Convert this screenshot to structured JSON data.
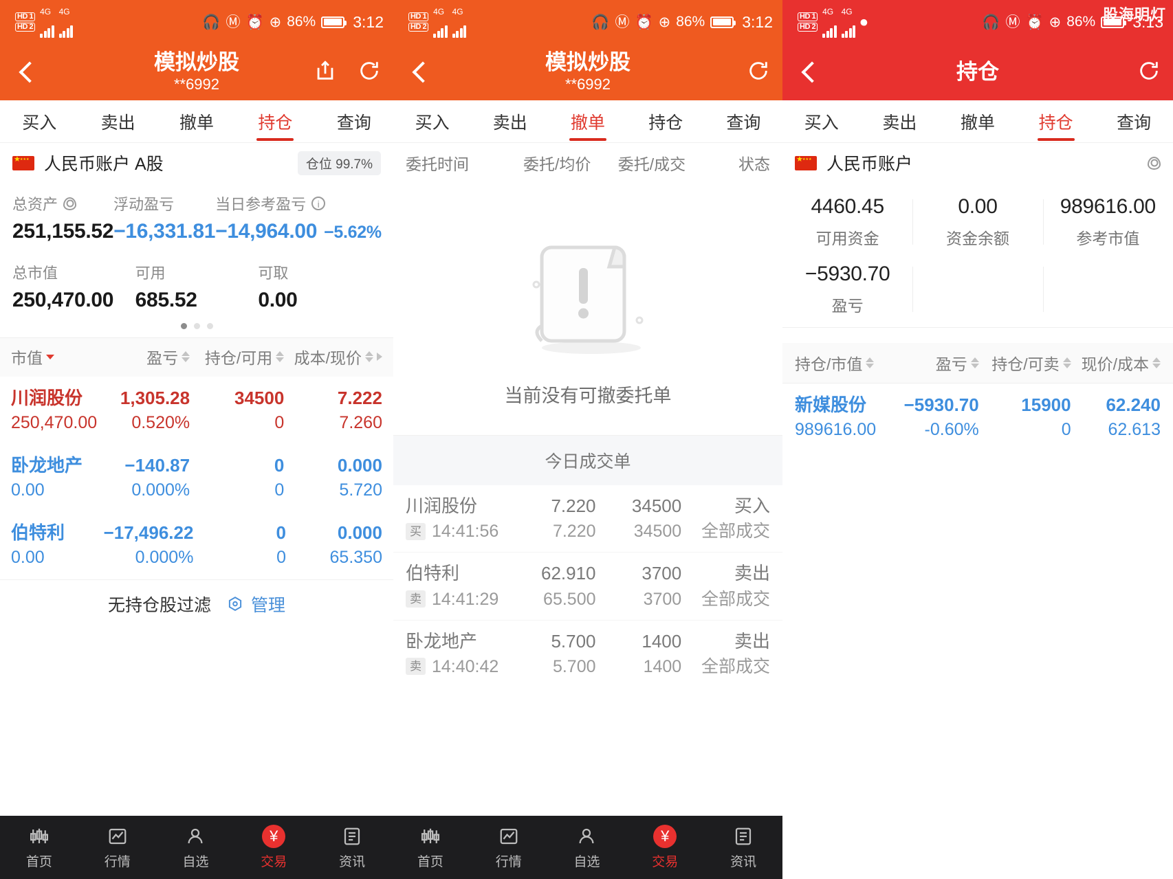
{
  "panel1": {
    "status": {
      "hd1": "HD 1",
      "hd2": "HD 2",
      "g1": "4G",
      "g2": "4G",
      "headset_icon": "headset-icon",
      "nfc_icon": "nfc-icon",
      "alarm_icon": "alarm-icon",
      "dnd_icon": "do-not-disturb-icon",
      "battery_pct": "86%",
      "time": "3:12"
    },
    "appbar": {
      "title": "模拟炒股",
      "subtitle": "**6992",
      "back_icon": "back-icon",
      "share_icon": "share-icon",
      "refresh_icon": "refresh-icon"
    },
    "tabs": [
      {
        "label": "买入",
        "active": false
      },
      {
        "label": "卖出",
        "active": false
      },
      {
        "label": "撤单",
        "active": false
      },
      {
        "label": "持仓",
        "active": true
      },
      {
        "label": "查询",
        "active": false
      }
    ],
    "account": {
      "name": "人民币账户 A股",
      "position_badge": "仓位 99.7%",
      "flag_icon": "china-flag-icon"
    },
    "assets": [
      {
        "label": "总资产",
        "value": "251,155.52",
        "icon": "eye-icon",
        "color": "dark"
      },
      {
        "label": "浮动盈亏",
        "value": "−16,331.81",
        "icon": "",
        "color": "blue"
      },
      {
        "label": "当日参考盈亏",
        "value": "−14,964.00",
        "sub": "−5.62%",
        "icon": "info-icon",
        "color": "blue"
      },
      {
        "label": "总市值",
        "value": "250,470.00",
        "icon": "",
        "color": "dark"
      },
      {
        "label": "可用",
        "value": "685.52",
        "icon": "",
        "color": "dark"
      },
      {
        "label": "可取",
        "value": "0.00",
        "icon": "",
        "color": "dark"
      }
    ],
    "pager": {
      "count": 3,
      "active": 0
    },
    "table": {
      "headers": [
        "市值",
        "盈亏",
        "持仓/可用",
        "成本/现价"
      ],
      "rows": [
        {
          "name": "川润股份",
          "value": "250,470.00",
          "pl": "1,305.28",
          "plpct": "0.520%",
          "qty": "34500",
          "avail": "0",
          "cost": "7.222",
          "price": "7.260",
          "color": "red"
        },
        {
          "name": "卧龙地产",
          "value": "0.00",
          "pl": "−140.87",
          "plpct": "0.000%",
          "qty": "0",
          "avail": "0",
          "cost": "0.000",
          "price": "5.720",
          "color": "blue"
        },
        {
          "name": "伯特利",
          "value": "0.00",
          "pl": "−17,496.22",
          "plpct": "0.000%",
          "qty": "0",
          "avail": "0",
          "cost": "0.000",
          "price": "65.350",
          "color": "blue"
        }
      ]
    },
    "filter": {
      "label": "无持仓股过滤",
      "manage": "管理",
      "manage_icon": "hexagon-settings-icon"
    }
  },
  "panel2": {
    "status": {
      "hd1": "HD 1",
      "hd2": "HD 2",
      "g1": "4G",
      "g2": "4G",
      "battery_pct": "86%",
      "time": "3:12"
    },
    "appbar": {
      "title": "模拟炒股",
      "subtitle": "**6992",
      "back_icon": "back-icon",
      "refresh_icon": "refresh-icon"
    },
    "tabs": [
      {
        "label": "买入",
        "active": false
      },
      {
        "label": "卖出",
        "active": false
      },
      {
        "label": "撤单",
        "active": true
      },
      {
        "label": "持仓",
        "active": false
      },
      {
        "label": "查询",
        "active": false
      }
    ],
    "order_headers": [
      "委托时间",
      "委托/均价",
      "委托/成交",
      "状态"
    ],
    "empty": {
      "text": "当前没有可撤委托单",
      "icon": "empty-scroll-icon"
    },
    "trades_title": "今日成交单",
    "trades": [
      {
        "name": "川润股份",
        "side": "买",
        "time": "14:41:56",
        "price1": "7.220",
        "price2": "7.220",
        "qty1": "34500",
        "qty2": "34500",
        "status1": "买入",
        "status2": "全部成交"
      },
      {
        "name": "伯特利",
        "side": "卖",
        "time": "14:41:29",
        "price1": "62.910",
        "price2": "65.500",
        "qty1": "3700",
        "qty2": "3700",
        "status1": "卖出",
        "status2": "全部成交"
      },
      {
        "name": "卧龙地产",
        "side": "卖",
        "time": "14:40:42",
        "price1": "5.700",
        "price2": "5.700",
        "qty1": "1400",
        "qty2": "1400",
        "status1": "卖出",
        "status2": "全部成交"
      }
    ]
  },
  "panel3": {
    "status": {
      "hd1": "HD 1",
      "hd2": "HD 2",
      "g1": "4G",
      "g2": "4G",
      "battery_pct": "86%",
      "time": "3:13",
      "watermark": "股海明灯"
    },
    "appbar": {
      "title": "持仓",
      "back_icon": "back-icon",
      "refresh_icon": "refresh-icon"
    },
    "tabs": [
      {
        "label": "买入",
        "active": false
      },
      {
        "label": "卖出",
        "active": false
      },
      {
        "label": "撤单",
        "active": false
      },
      {
        "label": "持仓",
        "active": true
      },
      {
        "label": "查询",
        "active": false
      }
    ],
    "account": {
      "name": "人民币账户",
      "flag_icon": "china-flag-icon",
      "eye_icon": "eye-icon"
    },
    "assets": [
      {
        "value": "4460.45",
        "label": "可用资金"
      },
      {
        "value": "0.00",
        "label": "资金余额"
      },
      {
        "value": "989616.00",
        "label": "参考市值"
      }
    ],
    "assets2": [
      {
        "value": "−5930.70",
        "label": "盈亏"
      }
    ],
    "table": {
      "headers": [
        "持仓/市值",
        "盈亏",
        "持仓/可卖",
        "现价/成本"
      ],
      "rows": [
        {
          "name": "新媒股份",
          "value": "989616.00",
          "pl": "−5930.70",
          "plpct": "-0.60%",
          "qty": "15900",
          "avail": "0",
          "price": "62.240",
          "cost": "62.613",
          "color": "blue"
        }
      ]
    }
  },
  "bottomnav": {
    "items": [
      {
        "label": "首页",
        "icon": "home-candles-icon",
        "active": false
      },
      {
        "label": "行情",
        "icon": "market-chart-icon",
        "active": false
      },
      {
        "label": "自选",
        "icon": "watchlist-person-icon",
        "active": false
      },
      {
        "label": "交易",
        "icon": "trade-yuan-icon",
        "active": true,
        "glyph": "¥"
      },
      {
        "label": "资讯",
        "icon": "news-doc-icon",
        "active": false
      }
    ]
  },
  "colors": {
    "orange": "#ef5a20",
    "red": "#e8312f",
    "accent_red": "#d92b1e",
    "up_red": "#c8342c",
    "down_blue": "#3e8ede",
    "nav_dark": "#1d1d1f"
  }
}
